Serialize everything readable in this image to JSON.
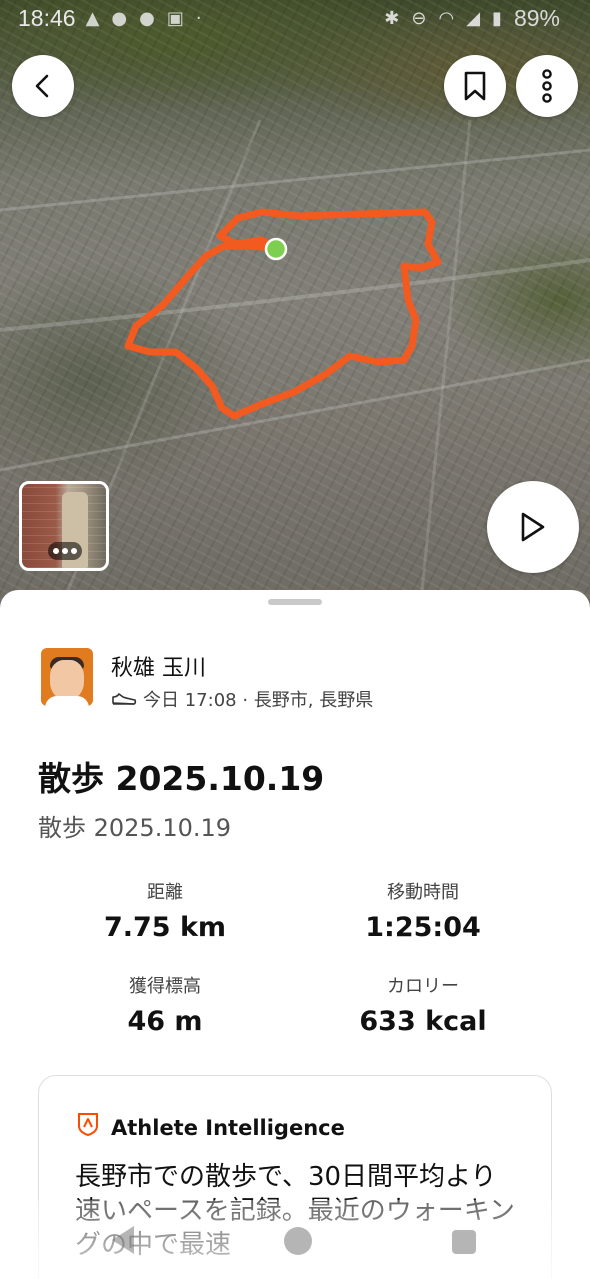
{
  "status_bar": {
    "time": "18:46",
    "battery": "89%",
    "left_icons": [
      "warning-icon",
      "facebook-icon",
      "facebook-icon",
      "photo-icon",
      "dot-icon"
    ],
    "right_icons": [
      "bluetooth-icon",
      "do-not-disturb-icon",
      "wifi-icon",
      "signal-icon",
      "battery-icon"
    ]
  },
  "map": {
    "route_color": "#f25a1f",
    "start_marker_color": "#7ccf4f",
    "buttons": [
      "back-icon",
      "bookmark-icon",
      "more-vertical-icon",
      "play-icon"
    ]
  },
  "athlete": {
    "name": "秋雄 玉川",
    "activity_icon": "shoe-icon",
    "meta": "今日 17:08 · 長野市, 長野県"
  },
  "activity": {
    "title": "散歩 2025.10.19",
    "subtitle": "散歩 2025.10.19"
  },
  "stats": {
    "distance": {
      "label": "距離",
      "value": "7.75 km"
    },
    "moving_time": {
      "label": "移動時間",
      "value": "1:25:04"
    },
    "elevation": {
      "label": "獲得標高",
      "value": "46 m"
    },
    "calories": {
      "label": "カロリー",
      "value": "633 kcal"
    }
  },
  "athlete_intelligence": {
    "title": "Athlete Intelligence",
    "text": "長野市での散歩で、30日間平均より速いペースを記録。最近のウォーキングの中で最速",
    "accent_color": "#fc4c02"
  },
  "colors": {
    "brand_orange": "#fc4c02",
    "text_primary": "#111111",
    "text_secondary": "#555555"
  }
}
